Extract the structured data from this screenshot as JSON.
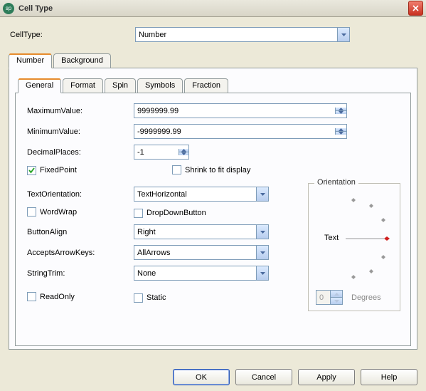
{
  "title": "Cell Type",
  "celltype_label": "CellType:",
  "celltype_value": "Number",
  "outer_tabs": [
    "Number",
    "Background"
  ],
  "inner_tabs": [
    "General",
    "Format",
    "Spin",
    "Symbols",
    "Fraction"
  ],
  "form": {
    "max_label": "MaximumValue:",
    "max_value": "9999999.99",
    "min_label": "MinimumValue:",
    "min_value": "-9999999.99",
    "dec_label": "DecimalPlaces:",
    "dec_value": "-1",
    "fixed_label": "FixedPoint",
    "shrink_label": "Shrink to fit display",
    "textorient_label": "TextOrientation:",
    "textorient_value": "TextHorizontal",
    "wordwrap_label": "WordWrap",
    "dropdown_label": "DropDownButton",
    "buttonalign_label": "ButtonAlign",
    "buttonalign_value": "Right",
    "arrowkeys_label": "AcceptsArrowKeys:",
    "arrowkeys_value": "AllArrows",
    "stringtrim_label": "StringTrim:",
    "stringtrim_value": "None",
    "readonly_label": "ReadOnly",
    "static_label": "Static"
  },
  "orientation": {
    "group_label": "Orientation",
    "center_text": "Text",
    "degrees_value": "0",
    "degrees_label": "Degrees"
  },
  "buttons": {
    "ok": "OK",
    "cancel": "Cancel",
    "apply": "Apply",
    "help": "Help"
  }
}
